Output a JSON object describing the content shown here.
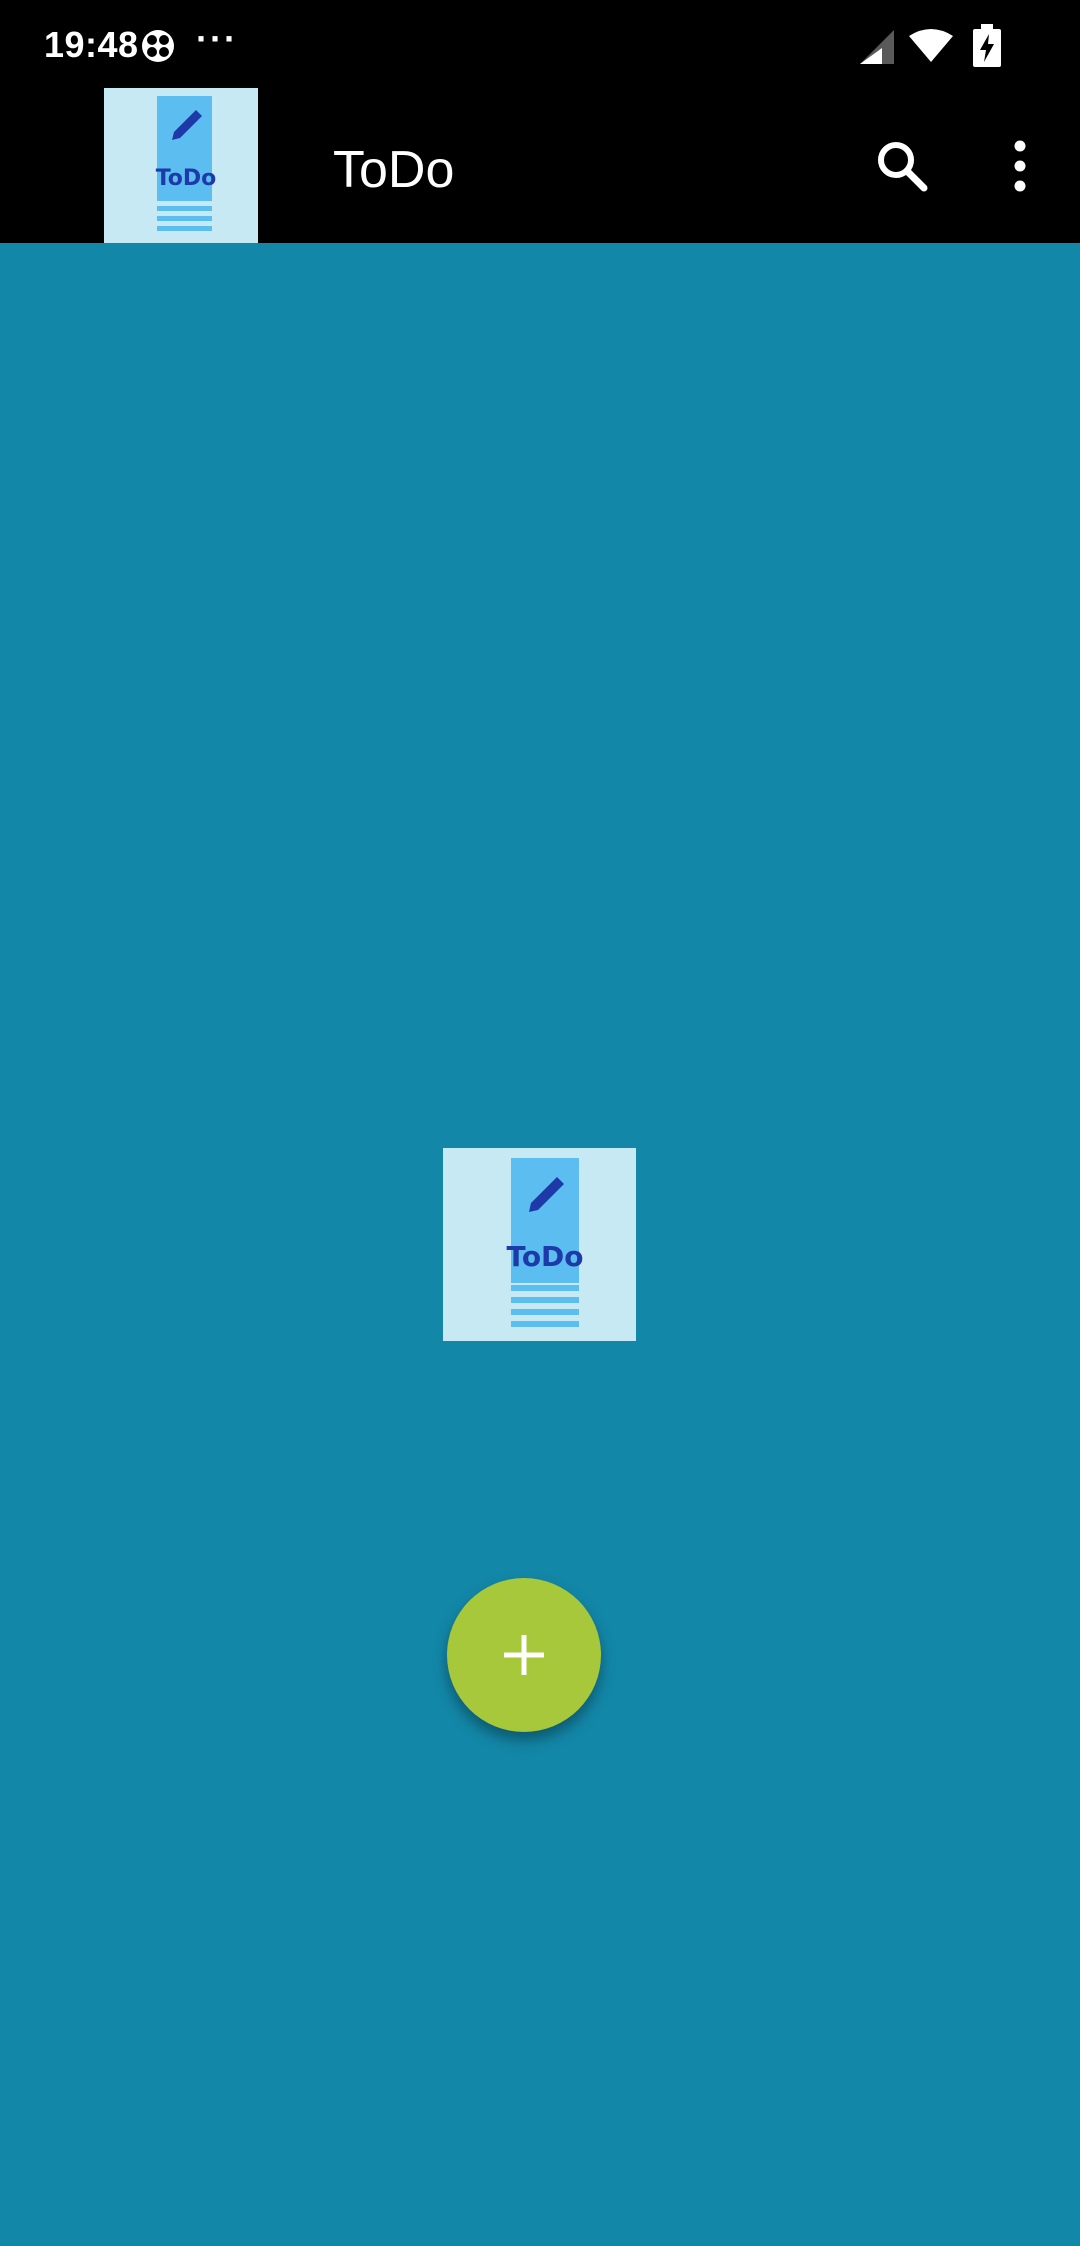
{
  "status_bar": {
    "time": "19:48",
    "more": "···",
    "icons": [
      "clover-icon",
      "signal-icon",
      "wifi-icon",
      "battery-charging-icon"
    ]
  },
  "app_bar": {
    "title": "ToDo",
    "logo_text": "ToDo",
    "actions": [
      "search-icon",
      "overflow-menu-icon"
    ]
  },
  "content": {
    "logo_text": "ToDo"
  },
  "fab": {
    "icon": "plus-icon"
  },
  "colors": {
    "background": "#1387a8",
    "app_bar": "#000000",
    "fab": "#a6c83a",
    "logo_bg": "#c6e9f3",
    "logo_panel": "#5bbdf0",
    "logo_text": "#1e3aa8"
  }
}
